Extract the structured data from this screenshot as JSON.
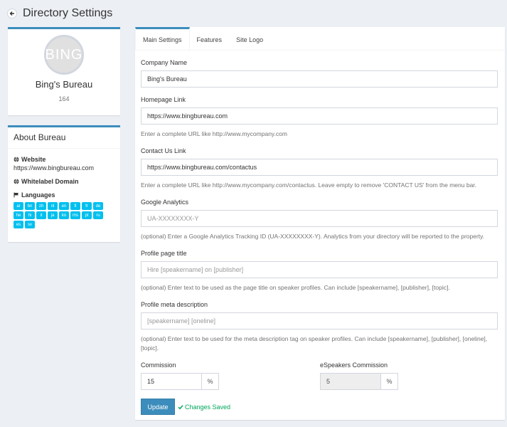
{
  "header": {
    "title": "Directory Settings"
  },
  "profile": {
    "avatar_text": "BING",
    "name": "Bing's Bureau",
    "count": "164"
  },
  "about": {
    "title": "About Bureau",
    "website_label": "Website",
    "website_value": "https://www.bingbureau.com",
    "whitelabel_label": "Whitelabel Domain",
    "languages_label": "Languages",
    "languages": [
      "ar",
      "bn",
      "zh",
      "nl",
      "en",
      "fi",
      "fr",
      "de",
      "he",
      "hi",
      "it",
      "ja",
      "ko",
      "ms",
      "pt",
      "ru",
      "es",
      "sv"
    ]
  },
  "tabs": [
    "Main Settings",
    "Features",
    "Site Logo"
  ],
  "form": {
    "company_name": {
      "label": "Company Name",
      "value": "Bing's Bureau"
    },
    "homepage": {
      "label": "Homepage Link",
      "value": "https://www.bingbureau.com",
      "help": "Enter a complete URL like http://www.mycompany.com"
    },
    "contact": {
      "label": "Contact Us Link",
      "value": "https://www.bingbureau.com/contactus",
      "help": "Enter a complete URL like http://www.mycompany.com/contactus. Leave empty to remove 'CONTACT US' from the menu bar."
    },
    "analytics": {
      "label": "Google Analytics",
      "placeholder": "UA-XXXXXXXX-Y",
      "help": "(optional) Enter a Google Analytics Tracking ID (UA-XXXXXXXX-Y). Analytics from your directory will be reported to the property."
    },
    "profile_title": {
      "label": "Profile page title",
      "placeholder": "Hire [speakername] on [publisher]",
      "help": "(optional) Enter text to be used as the page title on speaker profiles. Can include [speakername], [publisher], [topic]."
    },
    "meta_desc": {
      "label": "Profile meta description",
      "placeholder": "[speakername] [oneline]",
      "help": "(optional) Enter text to be used for the meta description tag on speaker profiles. Can include [speakername], [publisher], [oneline], [topic]."
    },
    "commission": {
      "label": "Commission",
      "value": "15",
      "addon": "%"
    },
    "espeakers_commission": {
      "label": "eSpeakers Commission",
      "value": "5",
      "addon": "%"
    },
    "update_label": "Update",
    "saved_label": "Changes Saved"
  },
  "colors": {
    "accent": "#3c8dbc",
    "badge": "#00c0ef",
    "success": "#00a65a"
  }
}
